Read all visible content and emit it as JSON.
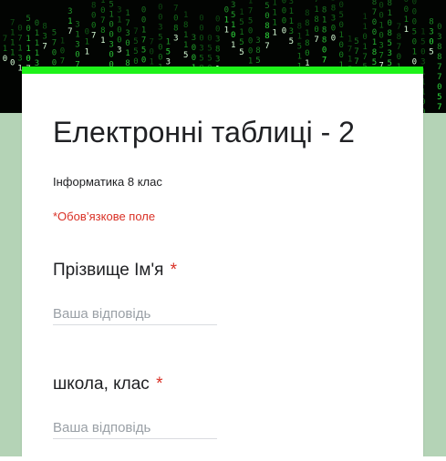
{
  "form": {
    "title": "Електронні таблиці - 2",
    "description": "Інформатика 8 клас",
    "required_note": "*Обов’язкове поле"
  },
  "questions": [
    {
      "label": "Прізвище Ім'я",
      "required_marker": "*",
      "placeholder": "Ваша відповідь"
    },
    {
      "label": "школа, клас",
      "required_marker": "*",
      "placeholder": "Ваша відповідь"
    }
  ],
  "theme": {
    "accent": "#1ef21a",
    "background": "#b4d3b6",
    "header_background": "#020402",
    "required_color": "#d93025"
  },
  "header_image": "matrix-code-banner"
}
